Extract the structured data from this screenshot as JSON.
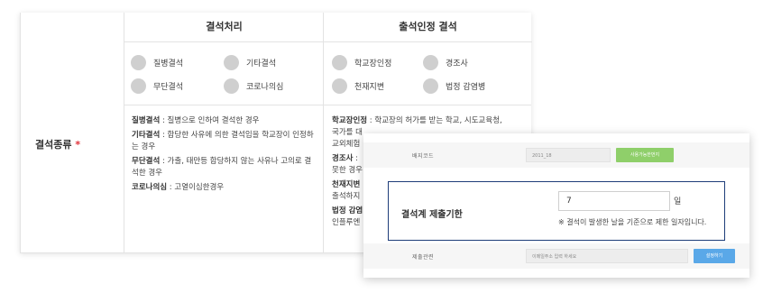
{
  "absence_form": {
    "row_label": "결석종류",
    "required_mark": "*",
    "sections": [
      {
        "title": "결석처리",
        "options": [
          "질병결석",
          "기타결석",
          "무단결석",
          "코로나의심"
        ],
        "descriptions": [
          {
            "term": "질병결석",
            "text": " : 질병으로 인하여 결석한 경우"
          },
          {
            "term": "기타결석",
            "text": " : 합당한 사유에 의한 결석임을 학교장이 인정하는 경우"
          },
          {
            "term": "무단결석",
            "text": " : 가출, 태만등 합당하지 않는 사유나 고의로 결석한 경우"
          },
          {
            "term": "코로나의심",
            "text": " : 고열이심한경우"
          }
        ]
      },
      {
        "title": "출석인정 결석",
        "options": [
          "학교장인정",
          "경조사",
          "천재지변",
          "법정 감염병"
        ],
        "descriptions": [
          {
            "term": "학교장인정",
            "text": " : 학교장의 허가를 받는 학교, 시도교육청,"
          },
          {
            "line2": "국가를 대"
          },
          {
            "line3": "교외체험"
          },
          {
            "term": "경조사",
            "text": " : "
          },
          {
            "line5": "못한 경우"
          },
          {
            "term": "천재지변",
            "text": ""
          },
          {
            "line7": "출석하지"
          },
          {
            "term": "법정 감염",
            "text": ""
          },
          {
            "line9": "인플루엔"
          }
        ]
      }
    ]
  },
  "settings_panel": {
    "blurred_rows": [
      {
        "label": "배지코드",
        "value": "2011_18",
        "button": "사용가능한번지"
      },
      {
        "label": "제출관련",
        "value": "이메일주소 입력 하세요",
        "button": "설정하기"
      }
    ],
    "deadline": {
      "label": "결석계 제출기한",
      "value": "7",
      "unit": "일",
      "note": "※ 결석이 발생한 날을 기준으로 제한 일자입니다."
    }
  },
  "colors": {
    "required": "#e0323a",
    "highlight_border": "#1e3d79",
    "radio": "#cfcfcf",
    "green_button": "#8fcf6a",
    "blue_button": "#5aa8e8"
  }
}
